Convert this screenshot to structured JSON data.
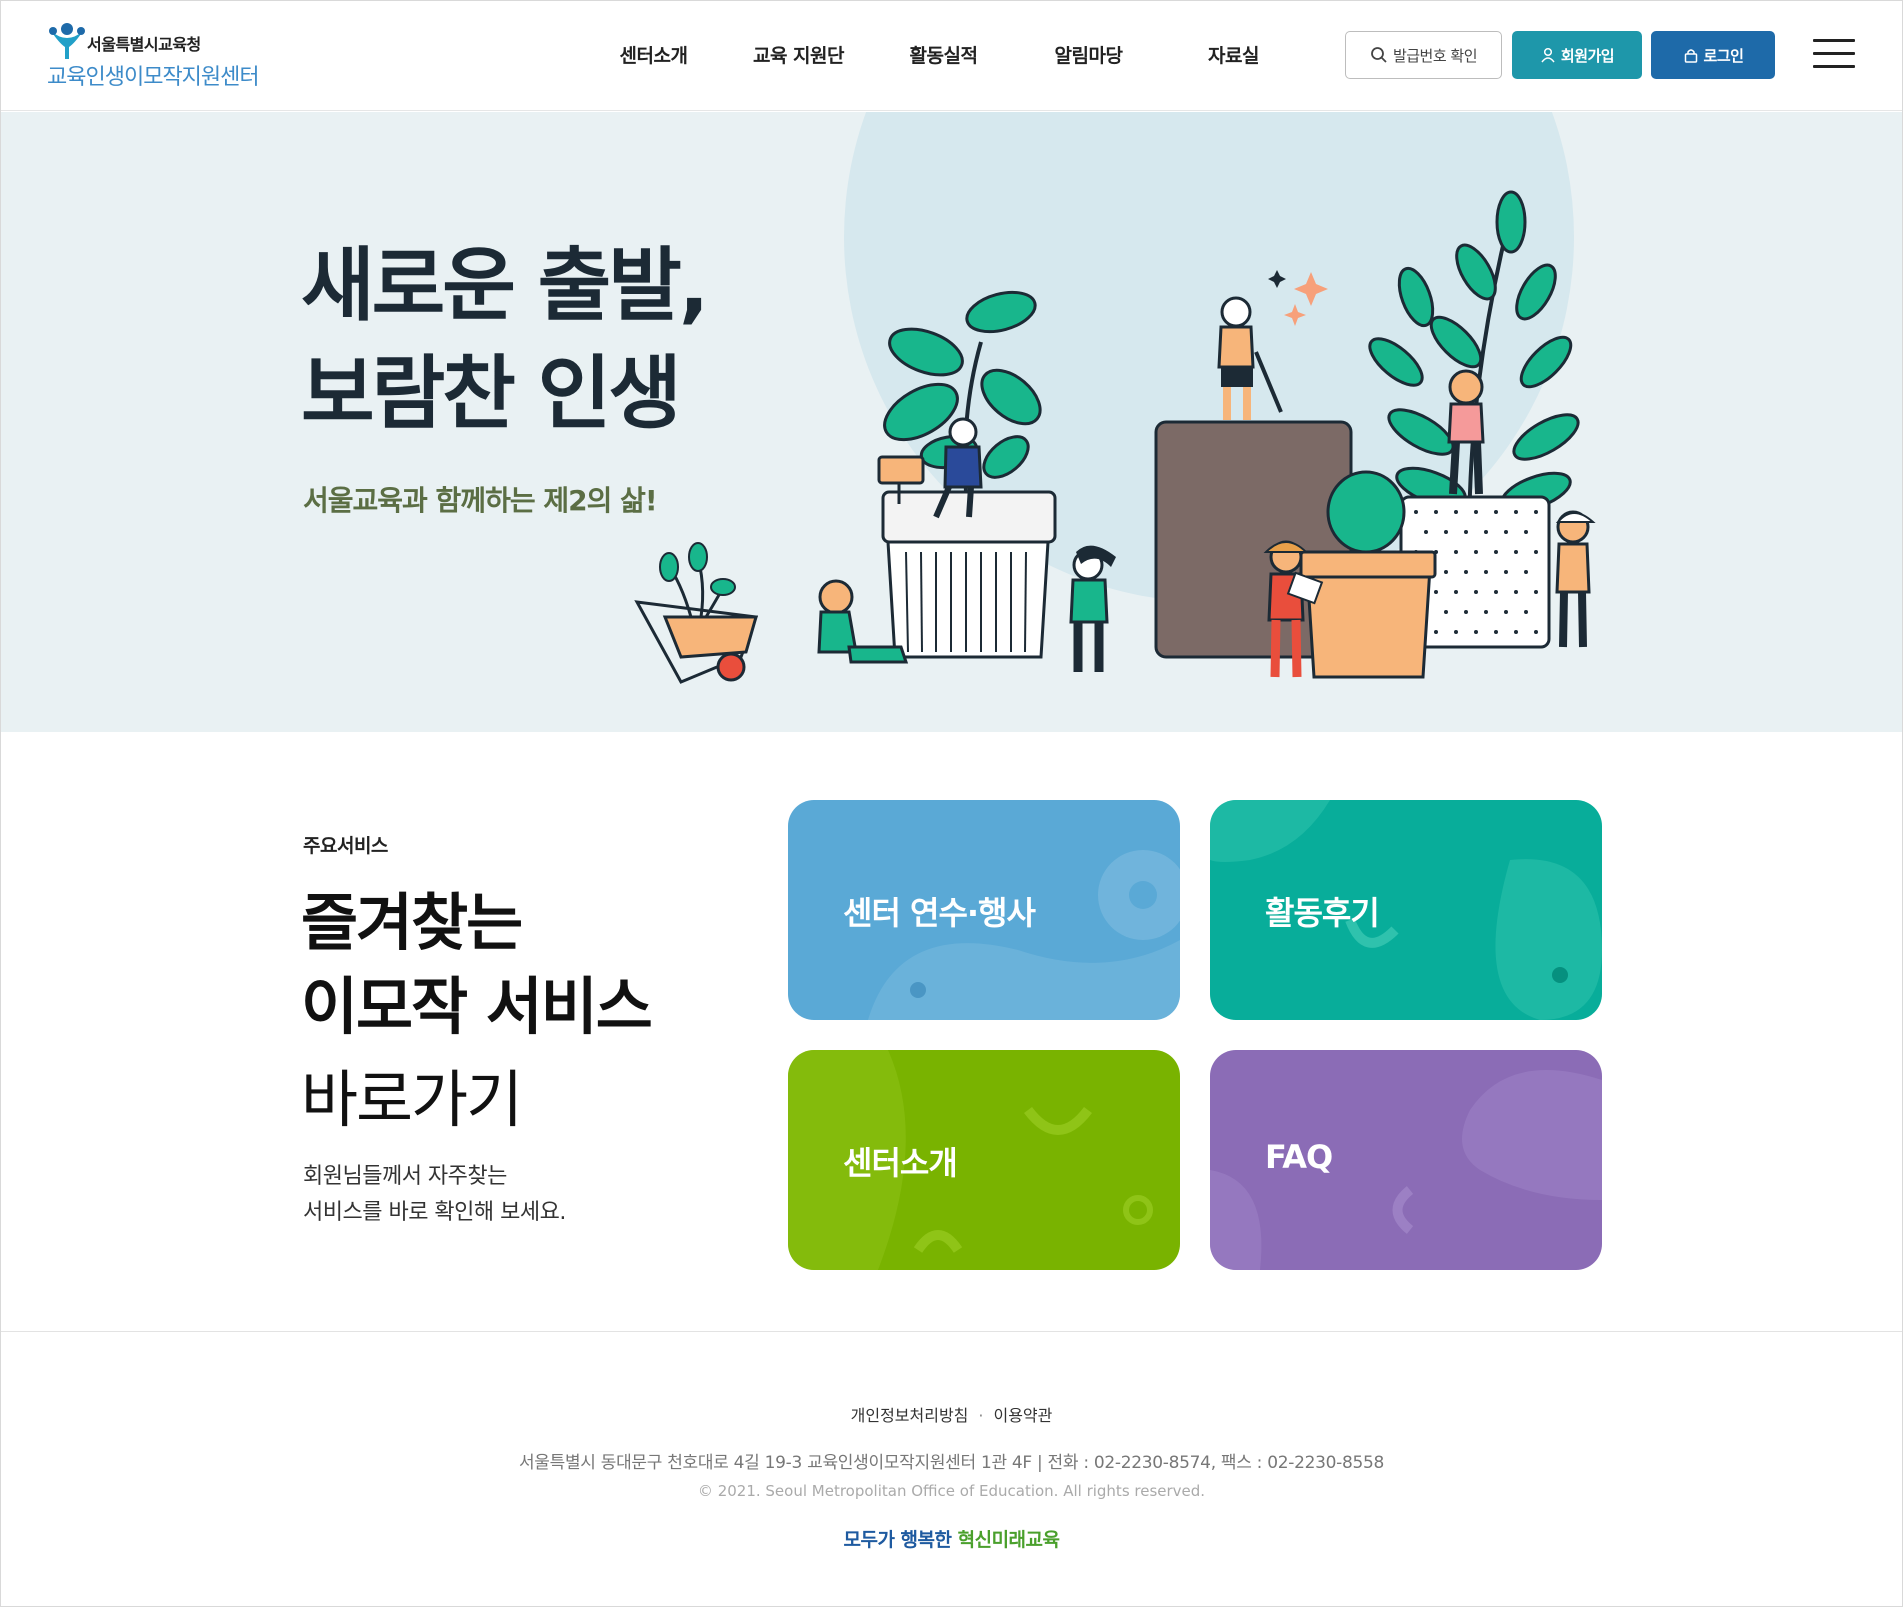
{
  "header": {
    "logo_top": "서울특별시교육청",
    "logo_bottom": "교육인생이모작지원센터",
    "nav": [
      "센터소개",
      "교육 지원단",
      "활동실적",
      "알림마당",
      "자료실"
    ],
    "issue_button": "발급번호 확인",
    "join_button": "회원가입",
    "login_button": "로그인"
  },
  "hero": {
    "title_line1": "새로운 출발,",
    "title_line2": "보람찬 인생",
    "subtitle": "서울교육과 함께하는 제2의 삶!"
  },
  "services": {
    "label": "주요서비스",
    "title_line1": "즐겨찾는",
    "title_line2": "이모작 서비스",
    "title_line3": "바로가기",
    "desc_line1": "회원님들께서 자주찾는",
    "desc_line2": "서비스를 바로 확인해 보세요.",
    "cards": [
      {
        "label": "센터 연수·행사",
        "color": "#5aa9d6"
      },
      {
        "label": "활동후기",
        "color": "#08ad9a"
      },
      {
        "label": "센터소개",
        "color": "#79b300"
      },
      {
        "label": "FAQ",
        "color": "#8b6cb6"
      }
    ]
  },
  "footer": {
    "privacy": "개인정보처리방침",
    "terms": "이용약관",
    "address": "서울특별시 동대문구 천호대로 4길 19-3 교육인생이모작지원센터 1관 4F | 전화 : 02-2230-8574, 팩스 : 02-2230-8558",
    "copyright": "© 2021. Seoul Metropolitan Office of Education. All rights reserved.",
    "slogan_a": "모두가 행복한",
    "slogan_b": "혁신미래교육"
  }
}
